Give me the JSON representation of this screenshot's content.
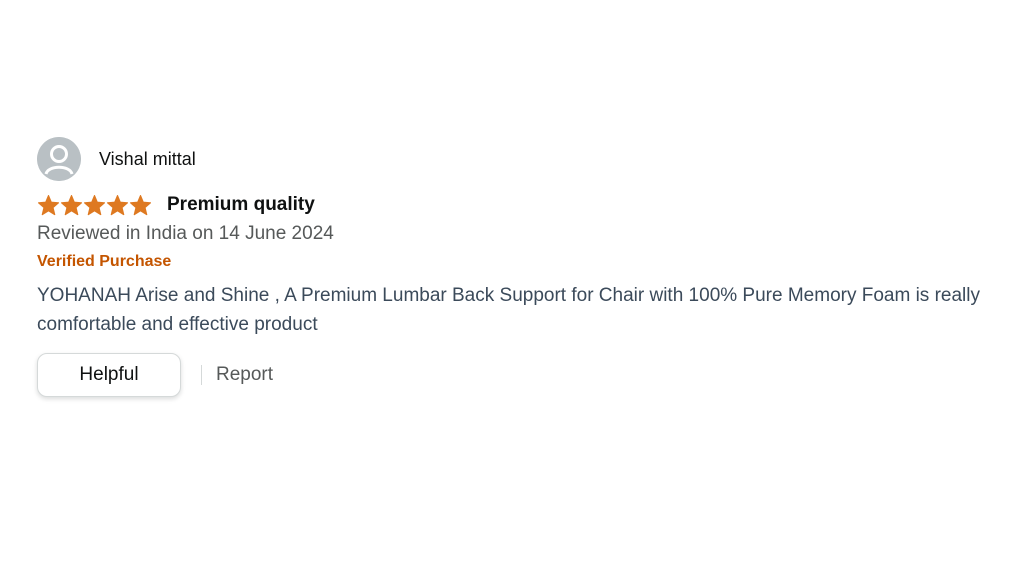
{
  "review": {
    "profile_name": "Vishal mittal",
    "avatar_icon": "user-silhouette-icon",
    "rating": 5,
    "rating_max": 5,
    "star_color": "#de7921",
    "title": "Premium quality",
    "date_text": "Reviewed in India on 14 June 2024",
    "verified_label": "Verified Purchase",
    "verified_color": "#c45500",
    "body": "YOHANAH Arise and Shine , A Premium Lumbar Back Support for Chair with 100% Pure Memory Foam is really comfortable and effective product",
    "actions": {
      "helpful_label": "Helpful",
      "report_label": "Report"
    }
  }
}
